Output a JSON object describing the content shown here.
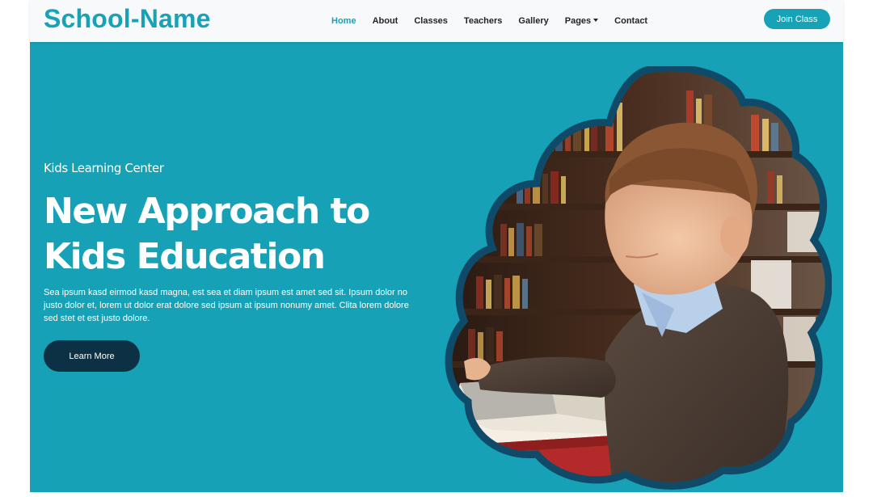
{
  "navbar": {
    "brand": "School-Name",
    "links": [
      {
        "label": "Home",
        "active": true
      },
      {
        "label": "About"
      },
      {
        "label": "Classes"
      },
      {
        "label": "Teachers"
      },
      {
        "label": "Gallery"
      },
      {
        "label": "Pages"
      },
      {
        "label": "Contact"
      }
    ],
    "cta": "Join Class"
  },
  "hero": {
    "subtitle": "Kids Learning Center",
    "title": "New Approach to Kids Education",
    "text": "Sea ipsum kasd eirmod kasd magna, est sea et diam ipsum est amet sed sit. Ipsum dolor no justo dolor et, lorem ut dolor erat dolore sed ipsum at ipsum nonumy amet. Clita lorem dolore sed stet et est justo dolore.",
    "button": "Learn More"
  },
  "colors": {
    "accent": "#17a2b8",
    "hero_bg": "#17a1b7",
    "dark_button": "#0c3144",
    "blob_border": "#0f4b68"
  }
}
